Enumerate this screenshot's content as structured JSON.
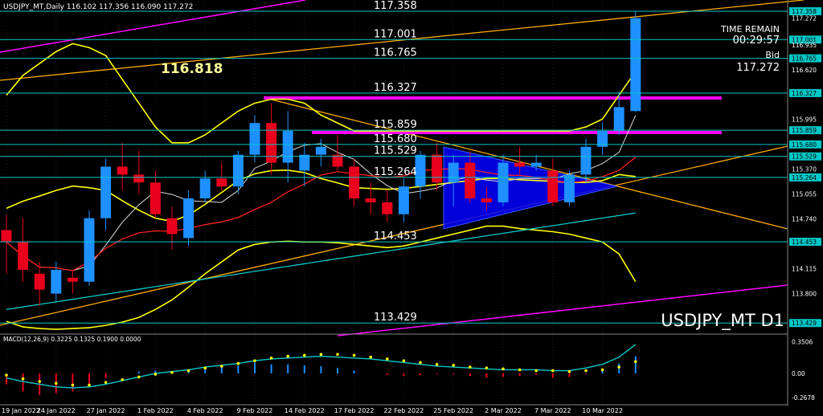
{
  "header": {
    "info": "USDJPY_MT,Daily  116.102 117.356 116.090 117.272"
  },
  "overlay": {
    "time_remain_label": "TIME REMAIN",
    "time_remain_value": "00:29:57",
    "bid_label": "Bid",
    "bid_value": "117.272",
    "big_level": "116.818",
    "symbol_watermark": "USDJPY_MT D1"
  },
  "colors": {
    "background": "#000000",
    "bull_candle": "#1e90ff",
    "bear_candle": "#e8001c",
    "level_line": "#00c8c8",
    "bollinger": "#ffff00",
    "channel": "#ffaa00",
    "magenta": "#ff00ff",
    "triangle_fill": "#0000ff",
    "macd_line": "#00c8c8",
    "signal_dots": "#ffff00"
  },
  "chart_data": [
    {
      "type": "candlestick",
      "symbol": "USDJPY_MT",
      "timeframe": "D1",
      "ylim": [
        113.31,
        117.5
      ],
      "y_ticks": [
        "117.358",
        "117.272",
        "117.001",
        "116.935",
        "116.765",
        "116.620",
        "116.327",
        "115.995",
        "115.859",
        "115.680",
        "115.529",
        "115.370",
        "115.264",
        "115.055",
        "114.740",
        "114.453",
        "114.115",
        "113.800",
        "113.429"
      ],
      "x_labels": [
        "19 Jan 2022",
        "24 Jan 2022",
        "27 Jan 2022",
        "1 Feb 2022",
        "4 Feb 2022",
        "9 Feb 2022",
        "14 Feb 2022",
        "17 Feb 2022",
        "22 Feb 2022",
        "25 Feb 2022",
        "2 Mar 2022",
        "7 Mar 2022",
        "10 Mar 2022"
      ],
      "x_label_index": [
        0,
        3,
        6,
        9,
        12,
        15,
        18,
        21,
        24,
        27,
        30,
        33,
        36
      ],
      "levels": [
        {
          "label": "117.358",
          "value": 117.358
        },
        {
          "label": "117.001",
          "value": 117.001
        },
        {
          "label": "116.765",
          "value": 116.765
        },
        {
          "label": "116.327",
          "value": 116.327
        },
        {
          "label": "115.859",
          "value": 115.859
        },
        {
          "label": "115.680",
          "value": 115.68
        },
        {
          "label": "115.529",
          "value": 115.529
        },
        {
          "label": "115.264",
          "value": 115.264
        },
        {
          "label": "114.453",
          "value": 114.453
        },
        {
          "label": "113.429",
          "value": 113.429
        }
      ],
      "candles": [
        {
          "o": 114.6,
          "h": 114.8,
          "l": 114.05,
          "c": 114.45
        },
        {
          "o": 114.45,
          "h": 114.75,
          "l": 113.95,
          "c": 114.1
        },
        {
          "o": 114.05,
          "h": 114.2,
          "l": 113.65,
          "c": 113.85
        },
        {
          "o": 113.8,
          "h": 114.2,
          "l": 113.7,
          "c": 114.1
        },
        {
          "o": 114.0,
          "h": 114.1,
          "l": 113.8,
          "c": 113.95
        },
        {
          "o": 113.95,
          "h": 114.85,
          "l": 113.9,
          "c": 114.75
        },
        {
          "o": 114.75,
          "h": 115.5,
          "l": 114.6,
          "c": 115.4
        },
        {
          "o": 115.4,
          "h": 115.7,
          "l": 115.1,
          "c": 115.3
        },
        {
          "o": 115.3,
          "h": 115.6,
          "l": 115.05,
          "c": 115.2
        },
        {
          "o": 115.2,
          "h": 115.35,
          "l": 114.75,
          "c": 114.8
        },
        {
          "o": 114.75,
          "h": 114.9,
          "l": 114.35,
          "c": 114.55
        },
        {
          "o": 114.5,
          "h": 115.1,
          "l": 114.4,
          "c": 115.0
        },
        {
          "o": 115.0,
          "h": 115.35,
          "l": 114.95,
          "c": 115.25
        },
        {
          "o": 115.25,
          "h": 115.45,
          "l": 115.1,
          "c": 115.15
        },
        {
          "o": 115.15,
          "h": 115.6,
          "l": 115.05,
          "c": 115.55
        },
        {
          "o": 115.55,
          "h": 116.05,
          "l": 115.45,
          "c": 115.95
        },
        {
          "o": 115.95,
          "h": 116.2,
          "l": 115.3,
          "c": 115.45
        },
        {
          "o": 115.45,
          "h": 116.1,
          "l": 115.2,
          "c": 115.85
        },
        {
          "o": 115.35,
          "h": 115.7,
          "l": 115.15,
          "c": 115.55
        },
        {
          "o": 115.55,
          "h": 115.75,
          "l": 115.4,
          "c": 115.65
        },
        {
          "o": 115.55,
          "h": 115.8,
          "l": 115.35,
          "c": 115.4
        },
        {
          "o": 115.4,
          "h": 115.5,
          "l": 114.9,
          "c": 115.0
        },
        {
          "o": 115.0,
          "h": 115.2,
          "l": 114.8,
          "c": 114.95
        },
        {
          "o": 114.95,
          "h": 115.1,
          "l": 114.7,
          "c": 114.8
        },
        {
          "o": 114.8,
          "h": 115.25,
          "l": 114.7,
          "c": 115.15
        },
        {
          "o": 115.15,
          "h": 115.6,
          "l": 115.0,
          "c": 115.55
        },
        {
          "o": 115.55,
          "h": 115.7,
          "l": 115.1,
          "c": 115.2
        },
        {
          "o": 115.2,
          "h": 115.55,
          "l": 114.9,
          "c": 115.45
        },
        {
          "o": 115.45,
          "h": 115.6,
          "l": 114.95,
          "c": 115.0
        },
        {
          "o": 115.0,
          "h": 115.15,
          "l": 114.85,
          "c": 114.95
        },
        {
          "o": 114.95,
          "h": 115.55,
          "l": 114.9,
          "c": 115.45
        },
        {
          "o": 115.45,
          "h": 115.65,
          "l": 115.3,
          "c": 115.4
        },
        {
          "o": 115.4,
          "h": 115.55,
          "l": 115.35,
          "c": 115.45
        },
        {
          "o": 115.35,
          "h": 115.5,
          "l": 114.9,
          "c": 114.95
        },
        {
          "o": 114.95,
          "h": 115.35,
          "l": 114.9,
          "c": 115.3
        },
        {
          "o": 115.3,
          "h": 115.75,
          "l": 115.2,
          "c": 115.65
        },
        {
          "o": 115.65,
          "h": 115.95,
          "l": 115.55,
          "c": 115.85
        },
        {
          "o": 115.85,
          "h": 116.35,
          "l": 115.8,
          "c": 116.15
        },
        {
          "o": 116.1,
          "h": 117.356,
          "l": 116.09,
          "c": 117.272
        }
      ],
      "bollinger": {
        "upper": [
          116.3,
          116.55,
          116.7,
          116.85,
          116.95,
          116.9,
          116.8,
          116.5,
          116.2,
          115.9,
          115.7,
          115.7,
          115.8,
          115.95,
          116.1,
          116.2,
          116.25,
          116.25,
          116.2,
          116.05,
          115.95,
          115.85,
          115.85,
          115.85,
          115.85,
          115.85,
          115.85,
          115.85,
          115.85,
          115.85,
          115.85,
          115.85,
          115.85,
          115.85,
          115.85,
          115.9,
          116.0,
          116.3,
          116.6
        ],
        "lower": [
          113.45,
          113.38,
          113.36,
          113.35,
          113.36,
          113.37,
          113.4,
          113.44,
          113.5,
          113.6,
          113.72,
          113.88,
          114.05,
          114.2,
          114.35,
          114.42,
          114.45,
          114.46,
          114.45,
          114.45,
          114.44,
          114.42,
          114.4,
          114.38,
          114.4,
          114.45,
          114.5,
          114.55,
          114.6,
          114.65,
          114.65,
          114.62,
          114.6,
          114.58,
          114.55,
          114.5,
          114.45,
          114.3,
          113.95
        ]
      },
      "macd": {
        "params": "MACD(12,26,9) 0.3225 0.1325 0.1900 0.0000",
        "ylim": [
          -0.33,
          0.4
        ],
        "y_ticks": [
          "0.3506",
          "0.00",
          "-0.2678"
        ],
        "histogram": [
          -0.12,
          -0.2,
          -0.24,
          -0.22,
          -0.2,
          -0.14,
          -0.05,
          0.0,
          0.02,
          0.03,
          0.02,
          0.03,
          0.05,
          0.07,
          0.09,
          0.12,
          0.1,
          0.1,
          0.09,
          0.08,
          0.06,
          0.03,
          0.0,
          -0.02,
          -0.03,
          -0.02,
          -0.01,
          -0.01,
          -0.03,
          -0.05,
          -0.04,
          -0.03,
          -0.02,
          -0.05,
          -0.04,
          -0.01,
          0.04,
          0.11,
          0.19
        ],
        "signal": [
          -0.02,
          -0.06,
          -0.09,
          -0.11,
          -0.13,
          -0.13,
          -0.1,
          -0.07,
          -0.04,
          -0.01,
          0.01,
          0.03,
          0.06,
          0.08,
          0.11,
          0.14,
          0.17,
          0.19,
          0.2,
          0.21,
          0.21,
          0.2,
          0.18,
          0.16,
          0.14,
          0.12,
          0.1,
          0.09,
          0.07,
          0.06,
          0.05,
          0.04,
          0.03,
          0.03,
          0.02,
          0.03,
          0.04,
          0.07,
          0.13
        ],
        "macd_line": [
          -0.05,
          -0.09,
          -0.12,
          -0.15,
          -0.16,
          -0.15,
          -0.12,
          -0.08,
          -0.04,
          0.0,
          0.02,
          0.04,
          0.07,
          0.09,
          0.11,
          0.14,
          0.16,
          0.17,
          0.18,
          0.19,
          0.18,
          0.17,
          0.16,
          0.14,
          0.12,
          0.1,
          0.08,
          0.07,
          0.06,
          0.05,
          0.04,
          0.04,
          0.04,
          0.03,
          0.03,
          0.06,
          0.1,
          0.18,
          0.32
        ]
      }
    }
  ]
}
